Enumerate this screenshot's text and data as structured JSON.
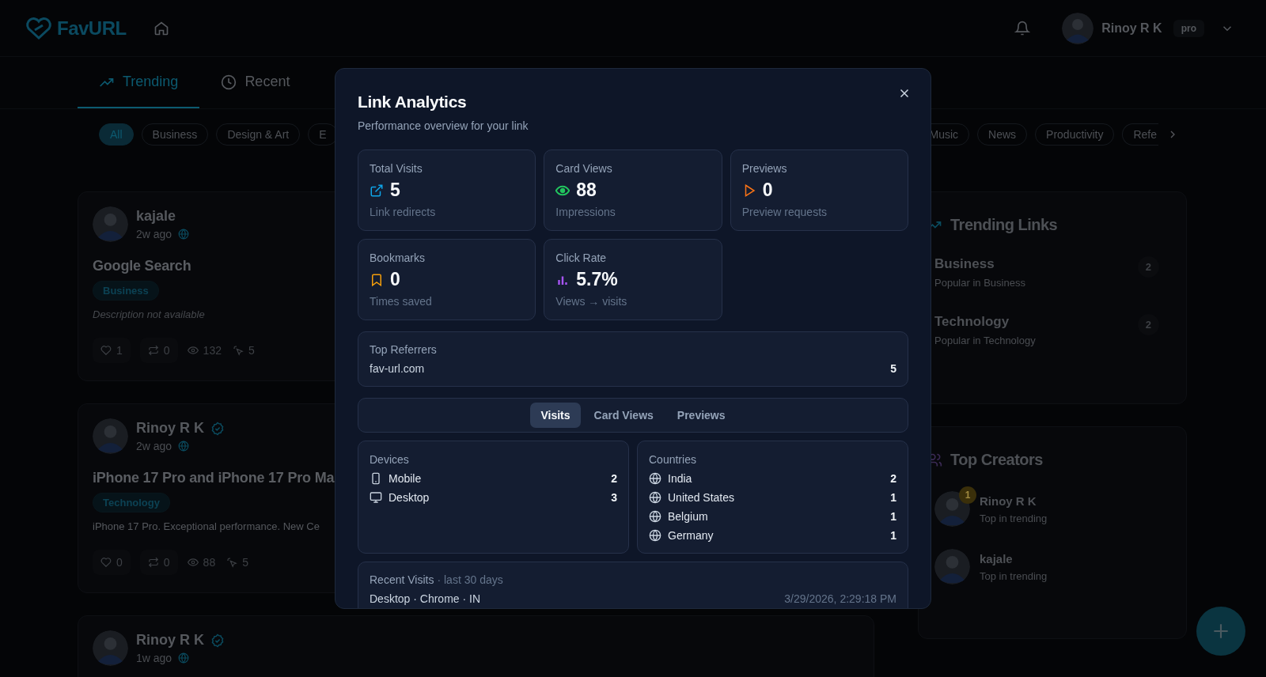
{
  "header": {
    "logo": "FavURL",
    "user": {
      "name": "Rinoy R K",
      "plan": "pro"
    }
  },
  "tabs": [
    {
      "label": "Trending",
      "selected": true
    },
    {
      "label": "Recent",
      "selected": false
    }
  ],
  "category_chips": [
    {
      "label": "All",
      "selected": true
    },
    {
      "label": "Business",
      "selected": false
    },
    {
      "label": "Design & Art",
      "selected": false
    },
    {
      "label": "E",
      "selected": false
    },
    {
      "label": "Music",
      "selected": false
    },
    {
      "label": "News",
      "selected": false
    },
    {
      "label": "Productivity",
      "selected": false
    },
    {
      "label": "Refe",
      "selected": false
    }
  ],
  "feed": [
    {
      "author": "kajale",
      "verified": false,
      "time": "2w ago",
      "title": "Google Search",
      "tag": "Business",
      "description": "Description not available",
      "description_missing": true,
      "likes": "1",
      "reposts": "0",
      "views": "132",
      "clicks": "5"
    },
    {
      "author": "Rinoy R K",
      "verified": true,
      "time": "2w ago",
      "title": "iPhone 17 Pro and iPhone 17 Pro Ma",
      "tag": "Technology",
      "description": "iPhone 17 Pro. Exceptional performance. New Ce",
      "description_missing": false,
      "likes": "0",
      "reposts": "0",
      "views": "88",
      "clicks": "5"
    },
    {
      "author": "Rinoy R K",
      "verified": true,
      "time": "1w ago"
    }
  ],
  "trending_links": {
    "title": "Trending Links",
    "items": [
      {
        "name": "Business",
        "subtitle": "Popular in Business",
        "count": "2"
      },
      {
        "name": "Technology",
        "subtitle": "Popular in Technology",
        "count": "2"
      }
    ]
  },
  "top_creators": {
    "title": "Top Creators",
    "items": [
      {
        "name": "Rinoy R K",
        "subtitle": "Top in trending",
        "rank": "1"
      },
      {
        "name": "kajale",
        "subtitle": "Top in trending"
      }
    ]
  },
  "dialog": {
    "title": "Link Analytics",
    "subtitle": "Performance overview for your link",
    "stats": [
      {
        "label": "Total Visits",
        "value": "5",
        "note": "Link redirects",
        "color": "#0ea5e9"
      },
      {
        "label": "Card Views",
        "value": "88",
        "note": "Impressions",
        "color": "#22c55e"
      },
      {
        "label": "Previews",
        "value": "0",
        "note": "Preview requests",
        "color": "#f97316"
      },
      {
        "label": "Bookmarks",
        "value": "0",
        "note": "Times saved",
        "color": "#f59e0b"
      },
      {
        "label": "Click Rate",
        "value": "5.7%",
        "note": "Views → visits",
        "color": "#a855f7"
      }
    ],
    "top_referrers": {
      "title": "Top Referrers",
      "rows": [
        {
          "name": "fav-url.com",
          "count": "5"
        }
      ]
    },
    "tabs": [
      {
        "label": "Visits",
        "selected": true
      },
      {
        "label": "Card Views",
        "selected": false
      },
      {
        "label": "Previews",
        "selected": false
      }
    ],
    "devices": {
      "title": "Devices",
      "rows": [
        {
          "name": "Mobile",
          "count": "2"
        },
        {
          "name": "Desktop",
          "count": "3"
        }
      ]
    },
    "countries": {
      "title": "Countries",
      "rows": [
        {
          "name": "India",
          "count": "2"
        },
        {
          "name": "United States",
          "count": "1"
        },
        {
          "name": "Belgium",
          "count": "1"
        },
        {
          "name": "Germany",
          "count": "1"
        }
      ]
    },
    "recent_visits": {
      "title": "Recent Visits",
      "period": "· last 30 days",
      "rows": [
        {
          "details": "Desktop · Chrome · IN",
          "time": "3/29/2026, 2:29:18 PM"
        }
      ]
    }
  }
}
